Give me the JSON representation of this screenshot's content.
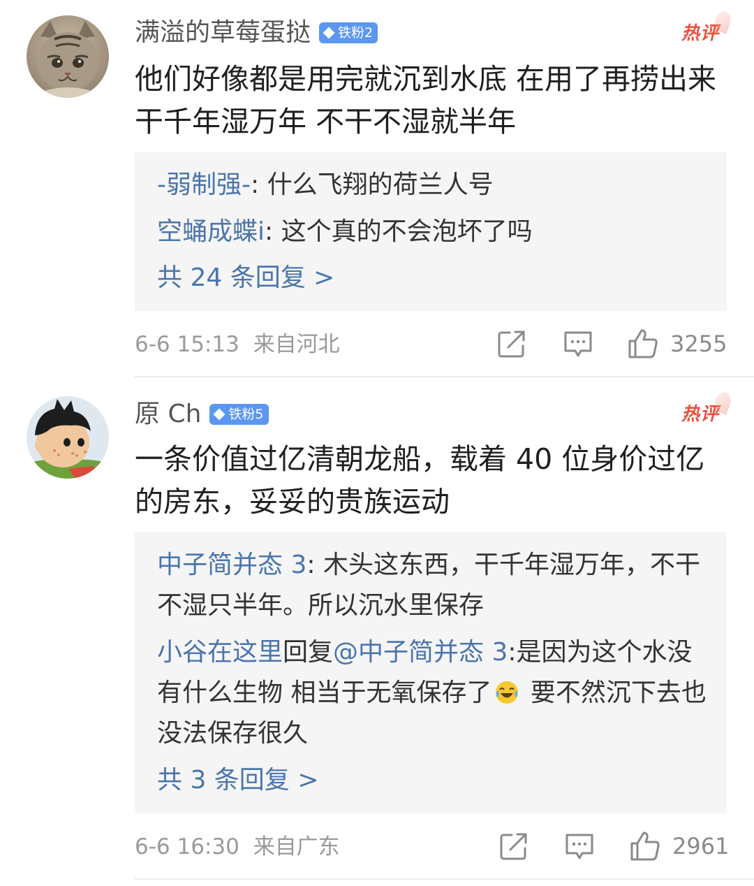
{
  "comments": [
    {
      "username": "满溢的草莓蛋挞",
      "badge": "铁粉2",
      "hot_label": "热评",
      "text": "他们好像都是用完就沉到水底  在用了再捞出来  干千年湿万年 不干不湿就半年",
      "replies": [
        {
          "author": "-弱制强-",
          "sep": ": ",
          "text": "什么飞翔的荷兰人号"
        },
        {
          "author": "空蛹成蝶i",
          "sep": ": ",
          "text": "这个真的不会泡坏了吗"
        }
      ],
      "more_replies": "共 24 条回复 >",
      "timestamp": "6-6 15:13",
      "location": "来自河北",
      "like_count": "3255",
      "icons": {
        "share": "share-icon",
        "comment": "comment-icon",
        "like": "thumbs-up-icon",
        "avatar": "cat-avatar"
      }
    },
    {
      "username": "原 Ch",
      "badge": "铁粉5",
      "hot_label": "热评",
      "text": "一条价值过亿清朝龙船，载着 40 位身价过亿的房东，妥妥的贵族运动",
      "replies": [
        {
          "author": "中子简并态 3",
          "sep": ": ",
          "text": "木头这东西，干千年湿万年，不干不湿只半年。所以沉水里保存"
        },
        {
          "author": "小谷在这里",
          "reply_word": "回复",
          "mention": "@中子简并态 3",
          "sep": ":",
          "text": "是因为这个水没有什么生物 相当于无氧保存了",
          "emoji": "laughing-crying-emoji",
          "text_after": " 要不然沉下去也没法保存很久"
        }
      ],
      "more_replies": "共 3 条回复 >",
      "timestamp": "6-6 16:30",
      "location": "来自广东",
      "like_count": "2961",
      "icons": {
        "share": "share-icon",
        "comment": "comment-icon",
        "like": "thumbs-up-icon",
        "avatar": "cartoon-boy-avatar"
      }
    }
  ],
  "colors": {
    "link_blue": "#4a75ad",
    "badge_blue": "#5b96f0",
    "hot_red": "#e8523f",
    "reply_bg": "#f5f5f5",
    "meta_gray": "#9a9a9a"
  }
}
